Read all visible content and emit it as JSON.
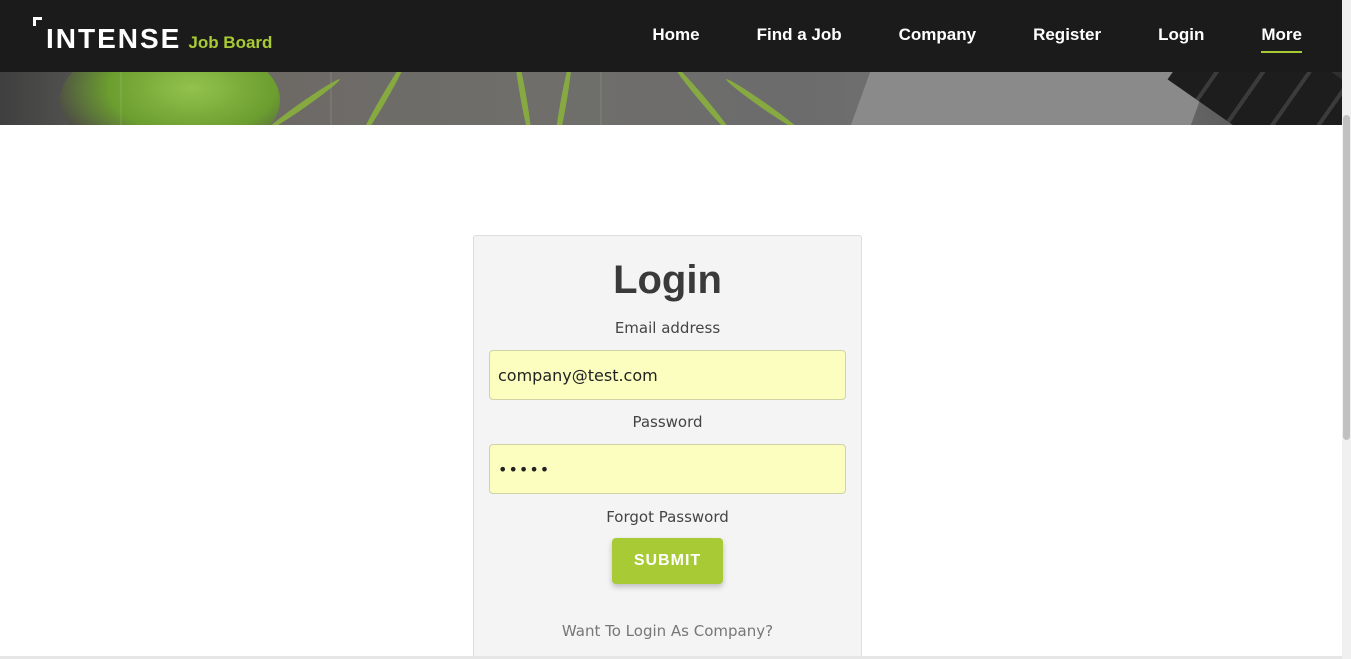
{
  "brand": {
    "name": "INTENSE",
    "subtitle": "Job Board"
  },
  "nav": {
    "items": [
      {
        "label": "Home"
      },
      {
        "label": "Find a Job"
      },
      {
        "label": "Company"
      },
      {
        "label": "Register"
      },
      {
        "label": "Login"
      },
      {
        "label": "More"
      }
    ],
    "active": "More"
  },
  "login": {
    "title": "Login",
    "email_label": "Email address",
    "email_value": "company@test.com",
    "password_label": "Password",
    "password_value": "•••••",
    "forgot_label": "Forgot Password",
    "submit_label": "SUBMIT",
    "alt_login_label": "Want To Login As Company?"
  },
  "colors": {
    "accent": "#a8cb35",
    "navbar": "#1b1b1b",
    "autofill": "#fbfebf"
  }
}
